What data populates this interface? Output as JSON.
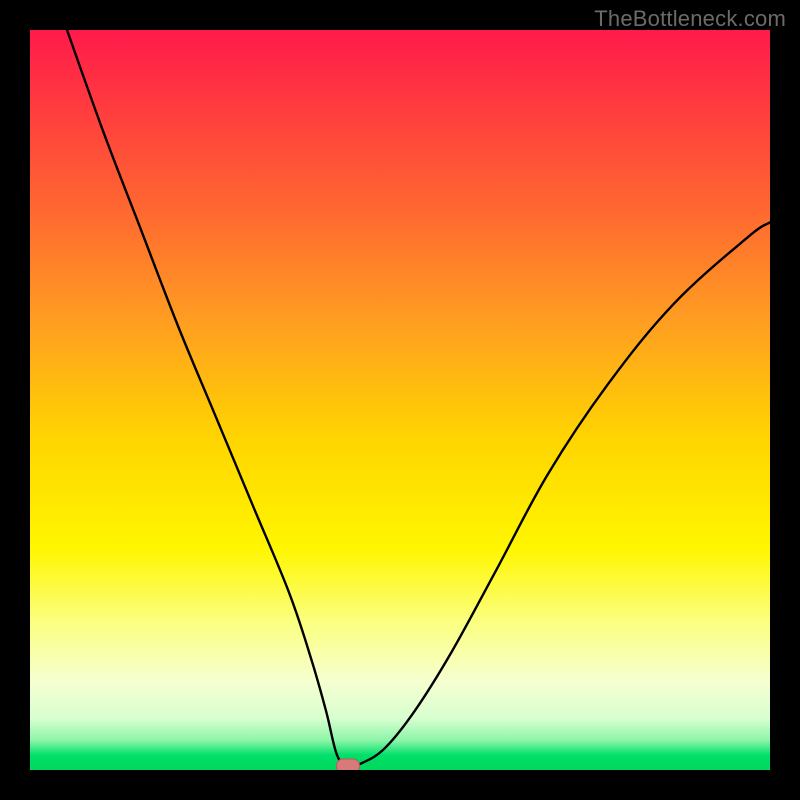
{
  "watermark": "TheBottleneck.com",
  "chart_data": {
    "type": "line",
    "title": "",
    "xlabel": "",
    "ylabel": "",
    "x_range": [
      0,
      100
    ],
    "y_range": [
      0,
      100
    ],
    "grid": false,
    "legend": false,
    "series": [
      {
        "name": "bottleneck-curve",
        "color": "#000000",
        "x": [
          5,
          10,
          15,
          20,
          25,
          30,
          35,
          38,
          40,
          41.5,
          43,
          45,
          48,
          52,
          57,
          63,
          70,
          78,
          87,
          97,
          100
        ],
        "y": [
          100,
          86,
          73,
          60,
          48,
          36,
          24,
          15,
          8,
          2,
          0.5,
          1,
          3,
          8,
          16,
          27,
          40,
          52,
          63,
          72,
          74
        ]
      }
    ],
    "marker": {
      "name": "optimal-point",
      "x": 43,
      "y": 0.5,
      "color": "#d97a7a"
    },
    "background_gradient": {
      "top": "#ff1a4b",
      "mid1": "#ffa020",
      "mid2": "#fff600",
      "bottom": "#00d75c"
    }
  }
}
